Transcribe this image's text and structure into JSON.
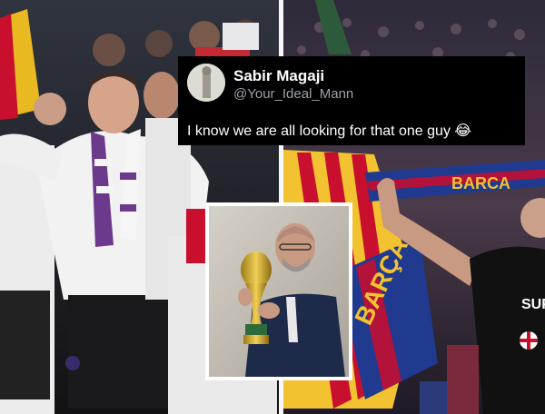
{
  "tweet": {
    "display_name": "Sabir Magaji",
    "handle": "@Your_Ideal_Mann",
    "text": "I know we are all looking for that one guy",
    "emoji": "😂"
  },
  "scarves": {
    "right_scarf_text": "BARCA",
    "right_flag_text": "BARÇA",
    "shirt_text": "SUP"
  },
  "colors": {
    "tweet_bg": "#000000",
    "tweet_text": "#ffffff",
    "handle_text": "#9aa1a8",
    "barca_blue": "#1f3a8f",
    "barca_red": "#b3123a",
    "gold": "#f2c230"
  },
  "icons": {
    "avatar": "profile-avatar",
    "trophy": "world-cup-trophy-image"
  }
}
